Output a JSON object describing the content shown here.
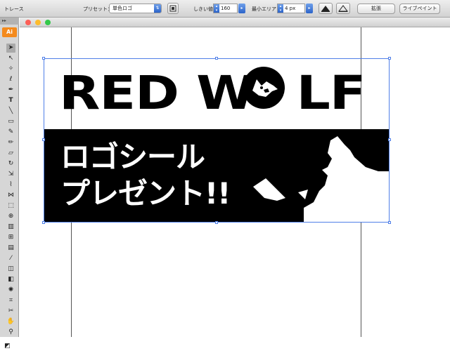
{
  "control_bar": {
    "title": "トレース",
    "preset_label": "プリセット：",
    "preset_value": "単色ロゴ",
    "threshold_label": "しきい値：",
    "threshold_value": "160",
    "min_area_label": "最小エリア：",
    "min_area_value": "4 px",
    "expand_button": "拡張",
    "live_paint_button": "ライブペイント"
  },
  "tools_panel": {
    "logo": "Ai",
    "grip": "▸▸",
    "tools": [
      "selection-tool",
      "direct-selection-tool",
      "magic-wand-tool",
      "lasso-tool",
      "pen-tool",
      "type-tool",
      "line-tool",
      "rectangle-tool",
      "paintbrush-tool",
      "pencil-tool",
      "rotate-tool",
      "scale-tool",
      "warp-tool",
      "free-transform-tool",
      "shape-builder-tool",
      "perspective-grid-tool",
      "mesh-tool",
      "gradient-tool",
      "eyedropper-tool",
      "blend-tool",
      "live-paint-bucket-tool",
      "live-paint-selection-tool",
      "symbol-sprayer-tool",
      "column-graph-tool",
      "artboard-tool",
      "slice-tool",
      "hand-tool",
      "zoom-tool"
    ]
  },
  "artwork": {
    "wordmark_left": "RED W",
    "wordmark_right": "LF",
    "banner_line1": "ロゴシール",
    "banner_line2": "プレゼント!!"
  },
  "colors": {
    "selection": "#4f7fe8",
    "ai_badge": "#f48a1d",
    "close_light": "#fc5f57",
    "min_light": "#fdbc2e",
    "max_light": "#34c84a"
  }
}
